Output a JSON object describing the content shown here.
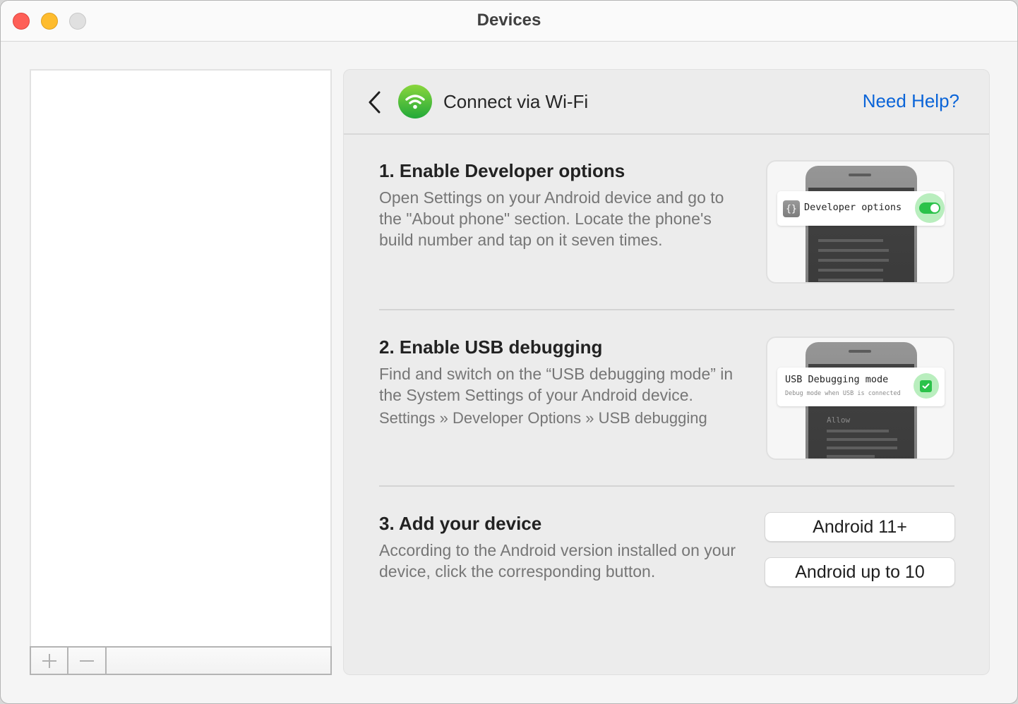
{
  "window": {
    "title": "Devices",
    "controls": [
      "close",
      "minimize",
      "zoom"
    ]
  },
  "device_list": {
    "items": [],
    "toolbar": {
      "add_icon": "plus-icon",
      "remove_icon": "minus-icon"
    }
  },
  "panel": {
    "back_icon": "chevron-left-icon",
    "header_icon": "wifi-icon",
    "title": "Connect via Wi-Fi",
    "help_link": "Need Help?",
    "accent_color": "#0a64d8"
  },
  "steps": [
    {
      "title": "1. Enable Developer options",
      "description": "Open Settings on your Android device and go to the \"About phone\" section. Locate the phone's build number and tap on it seven times.",
      "illustration": {
        "icon": "{}",
        "label": "Developer options",
        "control": "toggle",
        "state": "on"
      }
    },
    {
      "title": "2. Enable USB debugging",
      "description": "Find and switch on the “USB debugging mode” in the System Settings of your Android device.",
      "path": "Settings » Developer Options » USB debugging",
      "illustration": {
        "label": "USB Debugging mode",
        "sublabel": "Debug mode when USB is connected",
        "screen_text": "Allow",
        "control": "checkbox",
        "state": "checked"
      }
    },
    {
      "title": "3. Add your device",
      "description": "According to the Android version installed on your device, click the corresponding button.",
      "buttons": [
        {
          "label": "Android 11+"
        },
        {
          "label": "Android up to 10"
        }
      ]
    }
  ],
  "colors": {
    "toggle_on": "#2bc24a",
    "halo": "#b9eebe",
    "wifi_badge_top": "#8ad63c",
    "wifi_badge_bottom": "#22a93a"
  }
}
